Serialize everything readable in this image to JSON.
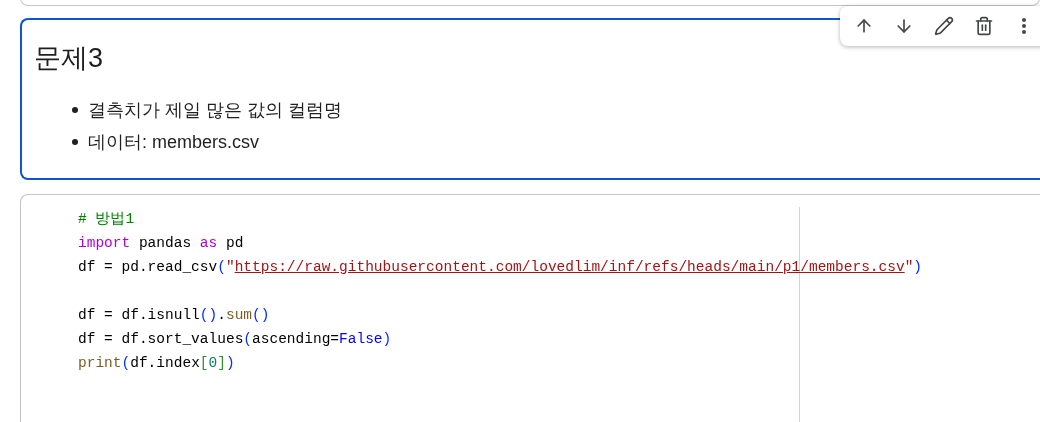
{
  "markdown_cell": {
    "heading": "문제3",
    "bullets": [
      "결측치가 제일 많은 값의 컬럼명",
      "데이터: members.csv"
    ],
    "selected": true
  },
  "cell_toolbar": [
    {
      "kind": "up"
    },
    {
      "kind": "down"
    },
    {
      "kind": "edit"
    },
    {
      "kind": "delete"
    },
    {
      "kind": "more"
    }
  ],
  "code_cell": {
    "lines": [
      [
        {
          "kind": "comment",
          "text": "# 방법1"
        }
      ],
      [
        {
          "kind": "keyword",
          "text": "import"
        },
        {
          "kind": "plain",
          "text": " pandas "
        },
        {
          "kind": "keyword",
          "text": "as"
        },
        {
          "kind": "plain",
          "text": " pd"
        }
      ],
      [
        {
          "kind": "plain",
          "text": "df = pd.read_csv"
        },
        {
          "kind": "paren",
          "text": "("
        },
        {
          "kind": "string",
          "text": "\""
        },
        {
          "kind": "link",
          "text": "https://raw.githubusercontent.com/lovedlim/inf/refs/heads/main/p1/members.csv"
        },
        {
          "kind": "string",
          "text": "\""
        },
        {
          "kind": "paren",
          "text": ")"
        }
      ],
      {
        "kind": "blank"
      },
      [
        {
          "kind": "plain",
          "text": "df = df.isnull"
        },
        {
          "kind": "paren",
          "text": "()"
        },
        {
          "kind": "plain",
          "text": "."
        },
        {
          "kind": "function",
          "text": "sum"
        },
        {
          "kind": "paren",
          "text": "()"
        }
      ],
      [
        {
          "kind": "plain",
          "text": "df = df.sort_values"
        },
        {
          "kind": "paren",
          "text": "("
        },
        {
          "kind": "plain",
          "text": "ascending="
        },
        {
          "kind": "constant",
          "text": "False"
        },
        {
          "kind": "paren",
          "text": ")"
        }
      ],
      [
        {
          "kind": "function",
          "text": "print"
        },
        {
          "kind": "paren",
          "text": "("
        },
        {
          "kind": "plain",
          "text": "df.index"
        },
        {
          "kind": "bracket",
          "text": "["
        },
        {
          "kind": "number",
          "text": "0"
        },
        {
          "kind": "bracket",
          "text": "]"
        },
        {
          "kind": "paren",
          "text": ")"
        }
      ]
    ]
  }
}
